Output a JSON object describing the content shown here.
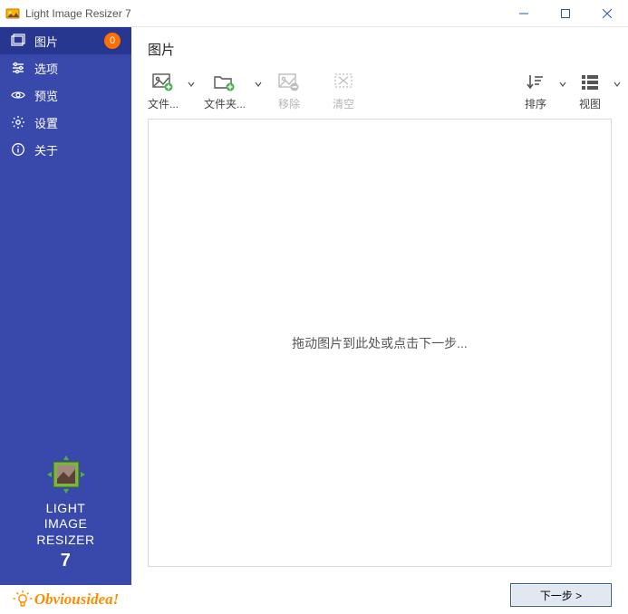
{
  "window": {
    "title": "Light Image Resizer 7"
  },
  "sidebar": {
    "items": [
      {
        "label": "图片",
        "badge": "0"
      },
      {
        "label": "选项"
      },
      {
        "label": "预览"
      },
      {
        "label": "设置"
      },
      {
        "label": "关于"
      }
    ],
    "product_name_l1": "LIGHT",
    "product_name_l2": "IMAGE",
    "product_name_l3": "RESIZER",
    "product_version": "7",
    "brand": "Obviousidea!"
  },
  "main": {
    "heading": "图片",
    "toolbar": {
      "add_file": "文件...",
      "add_folder": "文件夹...",
      "remove": "移除",
      "clear": "清空",
      "sort": "排序",
      "view": "视图"
    },
    "drop_hint": "拖动图片到此处或点击下一步...",
    "next": "下一步 >"
  }
}
